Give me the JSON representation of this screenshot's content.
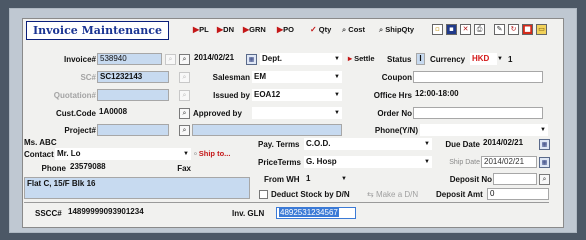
{
  "window": {
    "title": "Invoice Maintenance"
  },
  "toolbar": {
    "pl": "PL",
    "dn": "DN",
    "grn": "GRN",
    "po": "PO",
    "qty": "Qty",
    "cost": "Cost",
    "shipqty": "ShipQty"
  },
  "header": {
    "invoice_label": "Invoice#",
    "invoice_value": "538940",
    "date_value": "2014/02/21",
    "dept_label": "Dept.",
    "dept_value": "",
    "settle_label": "Settle",
    "status_label": "Status",
    "status_value": "I",
    "currency_label": "Currency",
    "currency_value": "HKD",
    "rate_value": "1",
    "sc_label": "SC#",
    "sc_value": "SC1232143",
    "salesman_label": "Salesman",
    "salesman_value": "EM",
    "coupon_label": "Coupon",
    "coupon_value": "",
    "quotation_label": "Quotation#",
    "quotation_value": "",
    "issuedby_label": "Issued by",
    "issuedby_value": "EOA12",
    "officehrs_label": "Office Hrs",
    "officehrs_value": "12:00-18:00",
    "custcode_label": "Cust.Code",
    "custcode_value": "1A0008",
    "approvedby_label": "Approved by",
    "approvedby_value": "",
    "orderno_label": "Order No",
    "orderno_value": "",
    "project_label": "Project#",
    "project_value": "",
    "phone_label": "Phone(Y/N)",
    "phone_value": ""
  },
  "customer": {
    "name": "Ms. ABC",
    "contact_label": "Contact",
    "contact_value": "Mr. Lo",
    "shipto_label": "Ship to...",
    "phone_label": "Phone",
    "phone_value": "23579088",
    "fax_label": "Fax",
    "fax_value": "",
    "address": "Flat C, 15/F Blk 16"
  },
  "terms": {
    "payterms_label": "Pay. Terms",
    "payterms_value": "C.O.D.",
    "duedate_label": "Due Date",
    "duedate_value": "2014/02/21",
    "priceterms_label": "PriceTerms",
    "priceterms_value": "G. Hosp",
    "shipdate_label": "Ship Date",
    "shipdate_value": "2014/02/21",
    "fromwh_label": "From WH",
    "fromwh_value": "1",
    "depositno_label": "Deposit No",
    "depositno_value": "",
    "deduct_label": "Deduct Stock by D/N",
    "makedn_label": "Make a D/N",
    "depositamt_label": "Deposit Amt",
    "depositamt_value": "0"
  },
  "footer": {
    "sscc_label": "SSCC#",
    "sscc_value": "14899999093901234",
    "gln_label": "Inv. GLN",
    "gln_value": "4892531234567"
  },
  "colors": {
    "title": "#1a3493",
    "accent_red": "#c41818",
    "field_blue": "#c7daf0",
    "selection": "#3b7ad6"
  }
}
